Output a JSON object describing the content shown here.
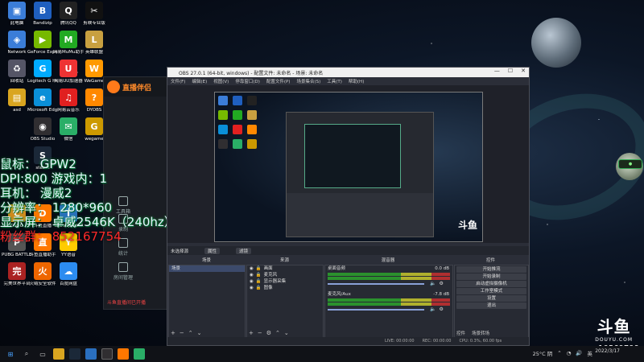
{
  "desktop_icons": [
    {
      "label": "此电脑",
      "color": "#3b7dd8",
      "glyph": "▣",
      "col": 0,
      "row": 0
    },
    {
      "label": "Bandizip",
      "color": "#1f5fbf",
      "glyph": "B",
      "col": 1,
      "row": 0
    },
    {
      "label": "腾讯QQ",
      "color": "#222",
      "glyph": "Q",
      "col": 2,
      "row": 0
    },
    {
      "label": "剪映专业版",
      "color": "#111",
      "glyph": "✂",
      "col": 3,
      "row": 0
    },
    {
      "label": "Network",
      "color": "#3b7dd8",
      "glyph": "◈",
      "col": 0,
      "row": 1
    },
    {
      "label": "GeForce Experience",
      "color": "#76b900",
      "glyph": "▶",
      "col": 1,
      "row": 1
    },
    {
      "label": "网易MuMu助手平台",
      "color": "#2a2",
      "glyph": "M",
      "col": 2,
      "row": 1
    },
    {
      "label": "英雄联盟",
      "color": "#c8a040",
      "glyph": "L",
      "col": 3,
      "row": 1
    },
    {
      "label": "回收站",
      "color": "#556",
      "glyph": "♻",
      "col": 0,
      "row": 2
    },
    {
      "label": "Logitech G HUB",
      "color": "#0af",
      "glyph": "G",
      "col": 1,
      "row": 2
    },
    {
      "label": "网易UU加速器",
      "color": "#e33",
      "glyph": "U",
      "col": 2,
      "row": 2
    },
    {
      "label": "WeGame",
      "color": "#f90",
      "glyph": "W",
      "col": 3,
      "row": 2
    },
    {
      "label": "asd",
      "color": "#d9a520",
      "glyph": "▤",
      "col": 0,
      "row": 3
    },
    {
      "label": "Microsoft Edge",
      "color": "#0a8fd8",
      "glyph": "e",
      "col": 1,
      "row": 3
    },
    {
      "label": "网易云音乐",
      "color": "#e02020",
      "glyph": "♫",
      "col": 2,
      "row": 3
    },
    {
      "label": "DYOBS",
      "color": "#f80",
      "glyph": "?",
      "col": 3,
      "row": 3
    },
    {
      "label": "OBS Studio",
      "color": "#302e31",
      "glyph": "◉",
      "col": 1,
      "row": 4
    },
    {
      "label": "微信",
      "color": "#2aae67",
      "glyph": "✉",
      "col": 2,
      "row": 4
    },
    {
      "label": "wegame",
      "color": "#c90",
      "glyph": "G",
      "col": 3,
      "row": 4
    },
    {
      "label": "steam",
      "color": "#1b2838",
      "glyph": "S",
      "col": 1,
      "row": 5
    },
    {
      "label": "CSGO",
      "color": "#d68a1e",
      "glyph": "C",
      "col": 0,
      "row": 7
    },
    {
      "label": "斗鱼直播",
      "color": "#f70",
      "glyph": "D",
      "col": 1,
      "row": 7
    },
    {
      "label": "TeamSpeak 3",
      "color": "#2a6fbf",
      "glyph": "T",
      "col": 2,
      "row": 7
    },
    {
      "label": "PUBG BATTLEGR...",
      "color": "#555",
      "glyph": "P",
      "col": 0,
      "row": 8
    },
    {
      "label": "斗鱼直播助手",
      "color": "#f70",
      "glyph": "直",
      "col": 1,
      "row": 8
    },
    {
      "label": "YY语音",
      "color": "#fc0",
      "glyph": "Y",
      "col": 2,
      "row": 8
    },
    {
      "label": "完美世界平台",
      "color": "#a22",
      "glyph": "完",
      "col": 0,
      "row": 9
    },
    {
      "label": "火绒安全软件",
      "color": "#e60",
      "glyph": "火",
      "col": 1,
      "row": 9
    },
    {
      "label": "百度网盘",
      "color": "#2c8cf0",
      "glyph": "☁",
      "col": 2,
      "row": 9
    }
  ],
  "overlay": {
    "mouse": "鼠标：    GPW2",
    "dpi": "DPI:800 游戏内：1",
    "headset": "耳机：   漫威2",
    "resolution": "分辨率：   1280*960",
    "monitor": "显示屏：   卓威2546K（240hz）",
    "fan_group": "粉丝群： 852167754"
  },
  "douyu": {
    "brand": "直播伴侣",
    "side_items": [
      "工具箱",
      "录制",
      "统计",
      "房间管理"
    ],
    "notice": "斗鱼直播间已开播"
  },
  "obs": {
    "title": "OBS 27.0.1 (64-bit, windows) - 配置文件: 未命名 - 场景: 未命名",
    "menu": [
      "文件(F)",
      "编辑(E)",
      "视图(V)",
      "停靠窗口(D)",
      "配置文件(P)",
      "场景集合(S)",
      "工具(T)",
      "帮助(H)"
    ],
    "ctx_label": "未选择源",
    "ctx_buttons": [
      "属性",
      "滤镜"
    ],
    "dock_titles": [
      "场景",
      "来源",
      "混音器",
      "转场",
      "控件"
    ],
    "scenes": [
      "场景"
    ],
    "sources": [
      "画面",
      "麦克风",
      "显示器采集",
      "图像"
    ],
    "mixer": [
      {
        "name": "桌面音频",
        "db": "0.0 dB"
      },
      {
        "name": "麦克风/Aux",
        "db": "-7.8 dB"
      }
    ],
    "controls": [
      "开始推流",
      "开始录制",
      "启动虚拟摄像机",
      "工作室模式",
      "设置",
      "退出"
    ],
    "control_tabs": [
      "控件",
      "场景转场"
    ],
    "status": [
      "LIVE: 00:00:00",
      "REC: 00:00:00",
      "CPU: 0.3%, 60.00 fps"
    ]
  },
  "watermark": {
    "logo": "斗鱼",
    "domain": "DOUYU.COM",
    "room_id": "10569799"
  },
  "taskbar": {
    "weather": "25°C 阴",
    "time": "",
    "date": "2022/3/17",
    "lang": "英"
  }
}
